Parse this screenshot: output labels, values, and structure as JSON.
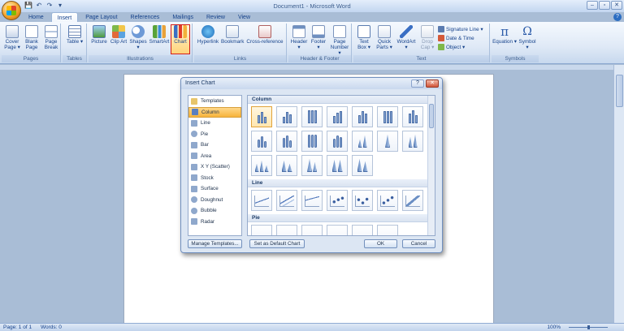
{
  "window": {
    "title": "Document1 - Microsoft Word",
    "controls": [
      "–",
      "▫",
      "✕"
    ]
  },
  "qat": [
    "💾",
    "↶",
    "↷",
    "▾"
  ],
  "tabs": [
    {
      "label": "Home"
    },
    {
      "label": "Insert",
      "active": true
    },
    {
      "label": "Page Layout"
    },
    {
      "label": "References"
    },
    {
      "label": "Mailings"
    },
    {
      "label": "Review"
    },
    {
      "label": "View"
    }
  ],
  "help": "?",
  "ribbon": {
    "groups": {
      "pages": "Pages",
      "tables": "Tables",
      "illustrations": "Illustrations",
      "links": "Links",
      "header_footer": "Header & Footer",
      "text": "Text",
      "symbols": "Symbols"
    },
    "buttons": {
      "cover_page": "Cover Page ▾",
      "blank_page": "Blank Page",
      "page_break": "Page Break",
      "table": "Table ▾",
      "picture": "Picture",
      "clip_art": "Clip Art",
      "shapes": "Shapes ▾",
      "smartart": "SmartArt",
      "chart": "Chart",
      "hyperlink": "Hyperlink",
      "bookmark": "Bookmark",
      "cross_reference": "Cross-reference",
      "header": "Header ▾",
      "footer": "Footer ▾",
      "page_number": "Page Number ▾",
      "text_box": "Text Box ▾",
      "quick_parts": "Quick Parts ▾",
      "wordart": "WordArt ▾",
      "drop_cap": "Drop Cap ▾",
      "signature_line": "Signature Line ▾",
      "date_time": "Date & Time",
      "object": "Object ▾",
      "equation": "Equation ▾",
      "symbol": "Symbol ▾"
    }
  },
  "dialog": {
    "title": "Insert Chart",
    "help": "?",
    "close": "✕",
    "categories": [
      "Templates",
      "Column",
      "Line",
      "Pie",
      "Bar",
      "Area",
      "X Y (Scatter)",
      "Stock",
      "Surface",
      "Doughnut",
      "Bubble",
      "Radar"
    ],
    "selected_category": "Column",
    "sections": {
      "column": "Column",
      "line": "Line",
      "pie": "Pie"
    },
    "buttons": {
      "manage_templates": "Manage Templates...",
      "set_default": "Set as Default Chart",
      "ok": "OK",
      "cancel": "Cancel"
    }
  },
  "status": {
    "page": "Page: 1 of 1",
    "words": "Words: 0",
    "zoom": "100%"
  },
  "colors": {
    "ribbon_text": "#15428b",
    "chart_highlight": "#d21a1a",
    "selected_item": "#f7b33b"
  }
}
